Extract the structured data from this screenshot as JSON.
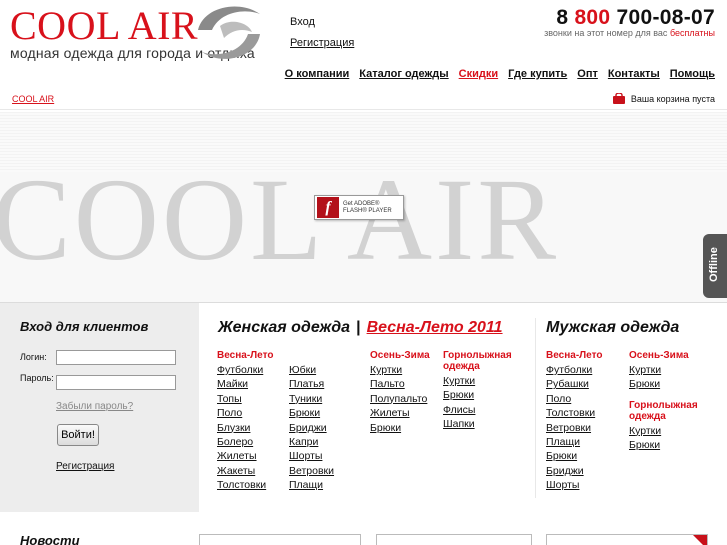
{
  "header": {
    "logo_title": "COOL AIR",
    "logo_subtitle": "модная одежда для города и отдыха",
    "login_link": "Вход",
    "register_link": "Регистрация",
    "phone_prefix": "8",
    "phone_code": "800",
    "phone_number": "700-08-07",
    "phone_note": "звонки на этот номер для вас",
    "phone_note_free": "бесплатны"
  },
  "nav": [
    {
      "label": "О компании"
    },
    {
      "label": "Каталог одежды"
    },
    {
      "label": "Скидки",
      "highlight": true
    },
    {
      "label": "Где купить"
    },
    {
      "label": "Опт"
    },
    {
      "label": "Контакты"
    },
    {
      "label": "Помощь"
    }
  ],
  "breadcrumb": "COOL AIR",
  "cart_text": "Ваша корзина пуста",
  "banner": {
    "word": "COOL AIR",
    "flash_line1": "Get ADOBE®",
    "flash_line2": "FLASH® PLAYER",
    "offline": "Offline"
  },
  "login": {
    "title": "Вход для клиентов",
    "login_label": "Логин:",
    "password_label": "Пароль:",
    "forgot": "Забыли пароль?",
    "button": "Войти!",
    "register": "Регистрация"
  },
  "women": {
    "title": "Женская одежда",
    "separator": "|",
    "season_link": "Весна-Лето 2011",
    "spring_title": "Весна-Лето",
    "spring_col1": [
      "Футболки",
      "Майки",
      "Топы",
      "Поло",
      "Блузки",
      "Болеро",
      "Жилеты",
      "Жакеты",
      "Толстовки"
    ],
    "spring_col2": [
      "Юбки",
      "Платья",
      "Туники",
      "Брюки",
      "Бриджи",
      "Капри",
      "Шорты",
      "Ветровки",
      "Плащи"
    ],
    "autumn_title": "Осень-Зима",
    "autumn": [
      "Куртки",
      "Пальто",
      "Полупальто",
      "Жилеты",
      "Брюки"
    ],
    "ski_title": "Горнолыжная одежда",
    "ski": [
      "Куртки",
      "Брюки",
      "Флисы",
      "Шапки"
    ]
  },
  "men": {
    "title": "Мужская одежда",
    "spring_title": "Весна-Лето",
    "spring": [
      "Футболки",
      "Рубашки",
      "Поло",
      "Толстовки",
      "Ветровки",
      "Плащи",
      "Брюки",
      "Бриджи",
      "Шорты"
    ],
    "autumn_title": "Осень-Зима",
    "autumn": [
      "Куртки",
      "Брюки"
    ],
    "ski_title": "Горнолыжная одежда",
    "ski": [
      "Куртки",
      "Брюки"
    ]
  },
  "news_title": "Новости",
  "colors": {
    "accent": "#d8111b",
    "panel_bg": "#ededed"
  }
}
